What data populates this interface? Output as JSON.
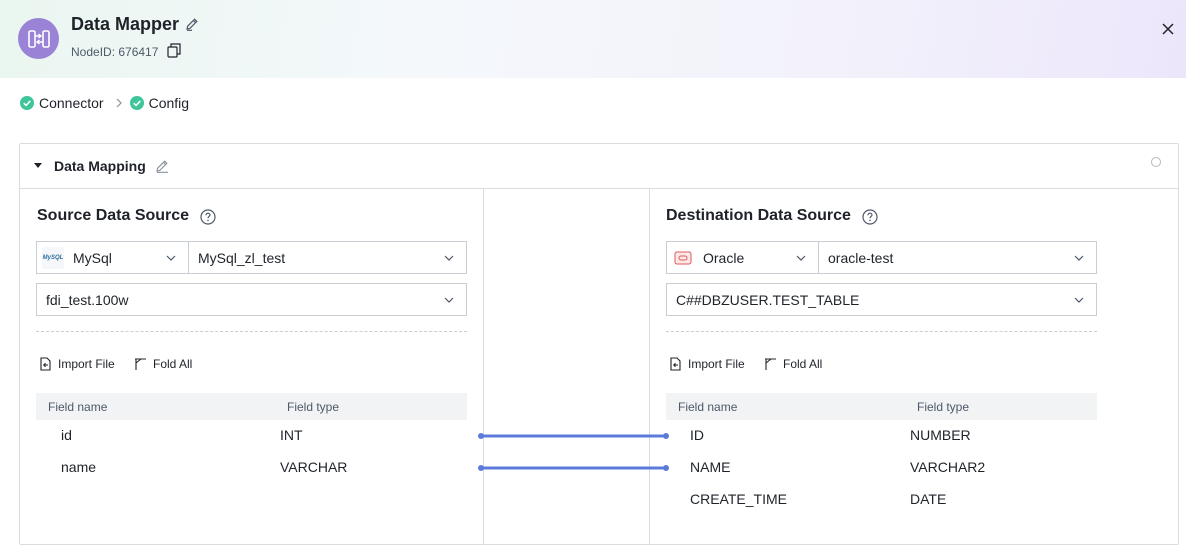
{
  "header": {
    "title": "Data Mapper",
    "node_id": "NodeID: 676417"
  },
  "steps": [
    {
      "label": "Connector"
    },
    {
      "label": "Config"
    }
  ],
  "panel": {
    "title": "Data Mapping"
  },
  "source": {
    "title": "Source Data Source",
    "db_type": "MySql",
    "db_logo_text": "MySQL",
    "connection": "MySql_zl_test",
    "table": "fdi_test.100w",
    "import_label": "Import File",
    "fold_label": "Fold All",
    "columns": [
      "Field name",
      "Field type"
    ],
    "rows": [
      {
        "name": "id",
        "type": "INT"
      },
      {
        "name": "name",
        "type": "VARCHAR"
      }
    ]
  },
  "destination": {
    "title": "Destination Data Source",
    "db_type": "Oracle",
    "connection": "oracle-test",
    "table": "C##DBZUSER.TEST_TABLE",
    "import_label": "Import File",
    "fold_label": "Fold All",
    "columns": [
      "Field name",
      "Field type"
    ],
    "rows": [
      {
        "name": "ID",
        "type": "NUMBER"
      },
      {
        "name": "NAME",
        "type": "VARCHAR2"
      },
      {
        "name": "CREATE_TIME",
        "type": "DATE"
      }
    ]
  },
  "mappings": [
    {
      "source": "id",
      "destination": "ID"
    },
    {
      "source": "name",
      "destination": "NAME"
    }
  ],
  "colors": {
    "accent_green": "#3ec59a",
    "link_blue": "#5b7bdc",
    "logo_purple": "#9a83d6"
  }
}
